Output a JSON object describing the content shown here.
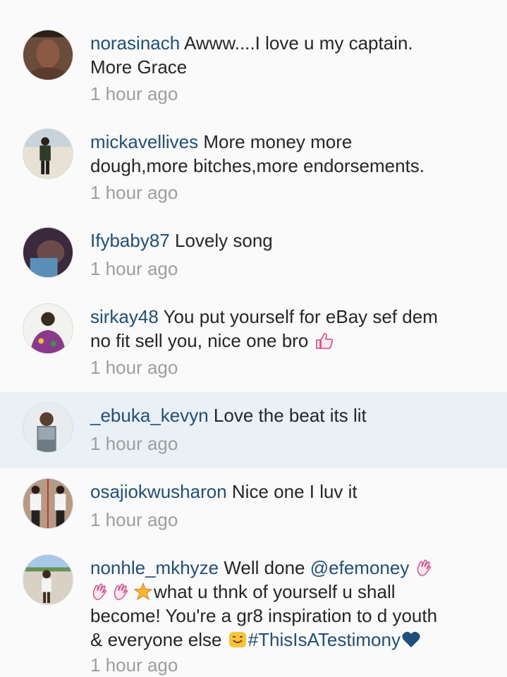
{
  "comments": [
    {
      "username": "norasinach",
      "text_1": "Awww....I love u my captain.",
      "text_2": "More Grace",
      "time": "1 hour ago"
    },
    {
      "username": "mickavellives",
      "text_1": "More money more",
      "text_2": "dough,more bitches,more endorsements.",
      "time": "1 hour ago"
    },
    {
      "username": "Ifybaby87",
      "text_1": "Lovely song",
      "time": "1 hour ago"
    },
    {
      "username": "sirkay48",
      "text_1": "You put yourself for eBay sef dem",
      "text_2": "no fit sell you, nice one bro",
      "emoji": "thumbs-up-icon",
      "time": "1 hour ago"
    },
    {
      "username": "_ebuka_kevyn",
      "text_1": "Love the beat its lit",
      "time": "1 hour ago"
    },
    {
      "username": "osajiokwusharon",
      "text_1": "Nice one I luv it",
      "time": "1 hour ago"
    },
    {
      "username": "nonhle_mkhyze",
      "text_1": "Well done",
      "mention": "@efemoney",
      "text_2": "what u thnk of yourself u shall",
      "text_3": "become! You're a gr8 inspiration to d youth",
      "text_4": "& everyone else",
      "hashtag": "#ThisIsATestimony",
      "emojis": [
        "clapping-hands-icon",
        "clapping-hands-icon",
        "clapping-hands-icon",
        "sparkle-icon",
        "flexed-face-icon",
        "heart-icon"
      ],
      "time": "1 hour ago"
    }
  ],
  "colors": {
    "username": "#1f4f7a",
    "text": "#262626",
    "time": "#9e9e9e",
    "highlight_row": "#e9f1f6",
    "background": "#fafafa"
  }
}
